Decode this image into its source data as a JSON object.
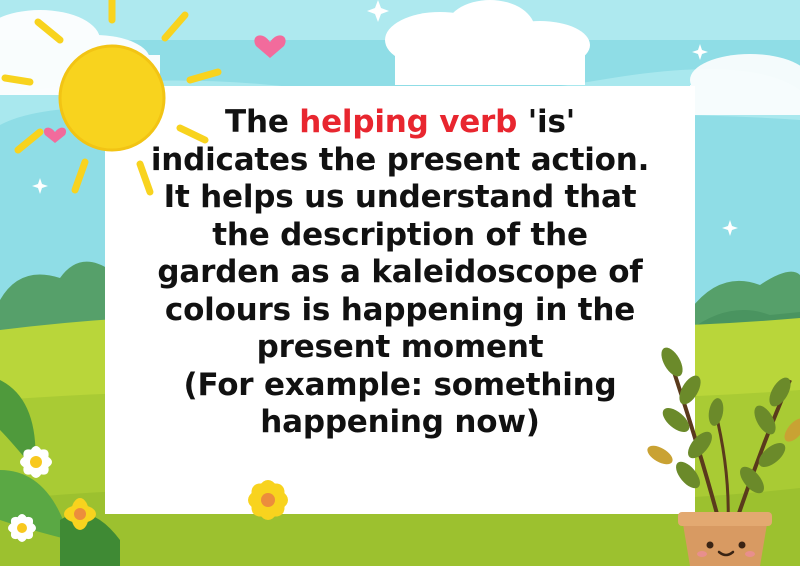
{
  "message": {
    "line1": {
      "before": "The ",
      "highlight": "helping verb",
      "after": " 'is'"
    },
    "line2": "indicates the present action.",
    "line3": "It helps us understand that",
    "line4": "the description of the",
    "line5": "garden as a kaleidoscope of",
    "line6": "colours is happening in the",
    "line7": "present moment",
    "line8": "(For example: something",
    "line9": "happening now)"
  },
  "colors": {
    "sky": "#8fdde6",
    "grass": "#b9d63a",
    "sun": "#f8d31e",
    "highlight": "#e8262f",
    "card": "#ffffff"
  },
  "decorations": [
    "sun-icon",
    "cloud-icon",
    "heart-icon",
    "sparkle-icon",
    "bush-icon",
    "daisy-icon",
    "leaf-plant-icon",
    "flower-pot-icon"
  ]
}
